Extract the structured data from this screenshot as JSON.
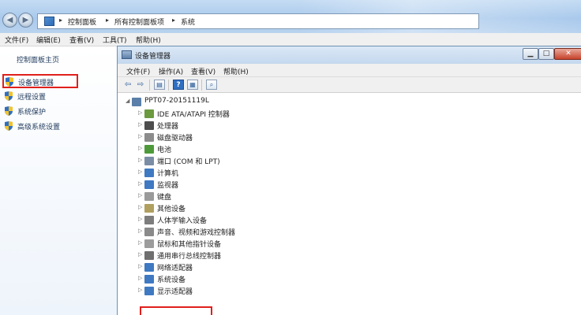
{
  "address_bar": {
    "crumbs": [
      "控制面板",
      "所有控制面板项",
      "系统"
    ]
  },
  "explorer_menu": [
    "文件(F)",
    "编辑(E)",
    "查看(V)",
    "工具(T)",
    "帮助(H)"
  ],
  "left_pane": {
    "home": "控制面板主页",
    "tasks": [
      "设备管理器",
      "远程设置",
      "系统保护",
      "高级系统设置"
    ]
  },
  "device_manager": {
    "title": "设备管理器",
    "menu": [
      "文件(F)",
      "操作(A)",
      "查看(V)",
      "帮助(H)"
    ],
    "root": "PPT07-20151119L",
    "devices": [
      {
        "label": "IDE ATA/ATAPI 控制器",
        "icon": "ide-controller-icon",
        "color": "#6b9a3f"
      },
      {
        "label": "处理器",
        "icon": "processor-icon",
        "color": "#4d4d4d"
      },
      {
        "label": "磁盘驱动器",
        "icon": "disk-drive-icon",
        "color": "#8c8c8c"
      },
      {
        "label": "电池",
        "icon": "battery-icon",
        "color": "#4e9a3a"
      },
      {
        "label": "端口 (COM 和 LPT)",
        "icon": "port-icon",
        "color": "#7a8da5"
      },
      {
        "label": "计算机",
        "icon": "computer-icon",
        "color": "#3f79c2"
      },
      {
        "label": "监视器",
        "icon": "monitor-icon",
        "color": "#3f79c2"
      },
      {
        "label": "键盘",
        "icon": "keyboard-icon",
        "color": "#9a9a9a"
      },
      {
        "label": "其他设备",
        "icon": "other-devices-icon",
        "color": "#b0a060"
      },
      {
        "label": "人体学输入设备",
        "icon": "hid-icon",
        "color": "#7d7d7d"
      },
      {
        "label": "声音、视频和游戏控制器",
        "icon": "sound-icon",
        "color": "#8a8a8a"
      },
      {
        "label": "鼠标和其他指针设备",
        "icon": "mouse-icon",
        "color": "#9c9c9c"
      },
      {
        "label": "通用串行总线控制器",
        "icon": "usb-icon",
        "color": "#6f6f6f"
      },
      {
        "label": "网络适配器",
        "icon": "network-adapter-icon",
        "color": "#3f79c2"
      },
      {
        "label": "系统设备",
        "icon": "system-devices-icon",
        "color": "#3f79c2"
      },
      {
        "label": "显示适配器",
        "icon": "display-adapter-icon",
        "color": "#3f79c2"
      }
    ]
  },
  "colors": {
    "highlight_box": "#e0201c",
    "link_text": "#1e395b",
    "titlebar": "#c4d8ee"
  }
}
